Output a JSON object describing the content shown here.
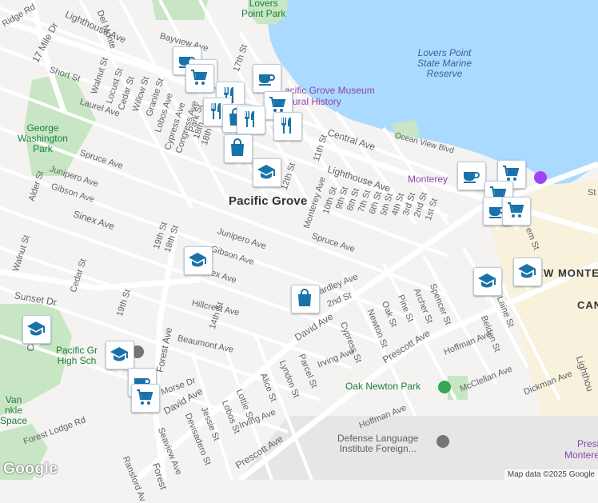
{
  "map": {
    "attribution": "Map data ©2025 Google",
    "logo": "Google",
    "city_labels": {
      "pacific_grove": "Pacific Grove",
      "new_monterey": "NEW MONTEREY",
      "cannery": "CAN"
    },
    "water_labels": {
      "lovers_point_reserve": "Lovers Point\nState Marine\nReserve"
    },
    "park_labels": {
      "lovers_point_park": "Lovers\nPoint Park",
      "george_washington_park": "George\nWashington\nPark",
      "pacific_grove_high": "Pacific Gr\nHigh Sch",
      "oak_newton_park": "Oak Newton Park",
      "van_winkle": "Van\nnkle\nSpace"
    },
    "poi_labels": {
      "museum": "acific Grove Museum\natural History",
      "monterey": "Monterey",
      "dli": "Defense Language\nInstitute Foreign...",
      "presidio": "Presid\nMonterey"
    },
    "streets": [
      {
        "name": "Lighthouse Ave",
        "key": "s1"
      },
      {
        "name": "Del Monte",
        "key": "s2"
      },
      {
        "name": "Ridge Rd",
        "key": "s3"
      },
      {
        "name": "17 Mile Dr",
        "key": "s4"
      },
      {
        "name": "Bayview Ave",
        "key": "s5"
      },
      {
        "name": "Short St",
        "key": "s6"
      },
      {
        "name": "Walnut St",
        "key": "s7"
      },
      {
        "name": "Locust St",
        "key": "s8"
      },
      {
        "name": "Cedar St",
        "key": "s9"
      },
      {
        "name": "Willow St",
        "key": "s10"
      },
      {
        "name": "Granite St",
        "key": "s11"
      },
      {
        "name": "Laurel Ave",
        "key": "s12"
      },
      {
        "name": "Lobos Ave",
        "key": "s13"
      },
      {
        "name": "Cypress Ave",
        "key": "s14"
      },
      {
        "name": "Congress Ave",
        "key": "s15"
      },
      {
        "name": "Park St",
        "key": "s16"
      },
      {
        "name": "18th",
        "key": "s17"
      },
      {
        "name": "18th",
        "key": "s18"
      },
      {
        "name": "17th St",
        "key": "s19"
      },
      {
        "name": "Central Ave",
        "key": "s20"
      },
      {
        "name": "Ocean View Blvd",
        "key": "s21"
      },
      {
        "name": "11th St",
        "key": "s22"
      },
      {
        "name": "Spruce Ave",
        "key": "s23"
      },
      {
        "name": "Junipero Ave",
        "key": "s24"
      },
      {
        "name": "Gibson Ave",
        "key": "s25"
      },
      {
        "name": "Alder St",
        "key": "s26"
      },
      {
        "name": "12th St",
        "key": "s27"
      },
      {
        "name": "Lighthouse Ave",
        "key": "s28"
      },
      {
        "name": "Monterey Ave",
        "key": "s29"
      },
      {
        "name": "10th St",
        "key": "s30"
      },
      {
        "name": "9th St",
        "key": "s31"
      },
      {
        "name": "8th St",
        "key": "s32"
      },
      {
        "name": "7th St",
        "key": "s33"
      },
      {
        "name": "6th St",
        "key": "s34"
      },
      {
        "name": "5th St",
        "key": "s35"
      },
      {
        "name": "4th St",
        "key": "s36"
      },
      {
        "name": "3rd St",
        "key": "s37"
      },
      {
        "name": "2nd St",
        "key": "s38"
      },
      {
        "name": "1st St",
        "key": "s39"
      },
      {
        "name": "Sinex Ave",
        "key": "s40"
      },
      {
        "name": "19th St",
        "key": "s41"
      },
      {
        "name": "18th St",
        "key": "s42"
      },
      {
        "name": "Junipero Ave",
        "key": "s43"
      },
      {
        "name": "Spruce Ave",
        "key": "s44"
      },
      {
        "name": "Gibson Ave",
        "key": "s45"
      },
      {
        "name": "Walnut St",
        "key": "s46"
      },
      {
        "name": "Cedar St",
        "key": "s47"
      },
      {
        "name": "Sunset Dr",
        "key": "s48"
      },
      {
        "name": "ex Ave",
        "key": "s49"
      },
      {
        "name": "Hillcrest Ave",
        "key": "s50"
      },
      {
        "name": "19th St",
        "key": "s51"
      },
      {
        "name": "Forest Ave",
        "key": "s52"
      },
      {
        "name": "14th St",
        "key": "s53"
      },
      {
        "name": "Beaumont Ave",
        "key": "s54"
      },
      {
        "name": "Cor",
        "key": "s55"
      },
      {
        "name": "ardley Ave",
        "key": "s56"
      },
      {
        "name": "2nd St",
        "key": "s57"
      },
      {
        "name": "David Ave",
        "key": "s58"
      },
      {
        "name": "Spencer St",
        "key": "s59"
      },
      {
        "name": "Archer St",
        "key": "s60"
      },
      {
        "name": "Pine St",
        "key": "s61"
      },
      {
        "name": "Oak St",
        "key": "s62"
      },
      {
        "name": "Newton St",
        "key": "s63"
      },
      {
        "name": "Cypress St",
        "key": "s64"
      },
      {
        "name": "Belden St",
        "key": "s65"
      },
      {
        "name": "Laine St",
        "key": "s66"
      },
      {
        "name": "Prescott Ave",
        "key": "s67"
      },
      {
        "name": "Hoffman Ave",
        "key": "s68"
      },
      {
        "name": "McClellan Ave",
        "key": "s69"
      },
      {
        "name": "Irving Ave",
        "key": "s70"
      },
      {
        "name": "Parcel St",
        "key": "s71"
      },
      {
        "name": "Lyndon St",
        "key": "s72"
      },
      {
        "name": "Alice St",
        "key": "s73"
      },
      {
        "name": "Morse Dr",
        "key": "s74"
      },
      {
        "name": "David Ave",
        "key": "s75"
      },
      {
        "name": "Lottie St",
        "key": "s76"
      },
      {
        "name": "Lobos St",
        "key": "s77"
      },
      {
        "name": "Jessie St",
        "key": "s78"
      },
      {
        "name": "Devisadero St",
        "key": "s79"
      },
      {
        "name": "Irving Ave",
        "key": "s80"
      },
      {
        "name": "Seaview Ave",
        "key": "s81"
      },
      {
        "name": "Forest Lodge Rd",
        "key": "s82"
      },
      {
        "name": "Ransford Av",
        "key": "s83"
      },
      {
        "name": "Forest",
        "key": "s84"
      },
      {
        "name": "Prescott Ave",
        "key": "s85"
      },
      {
        "name": "Hoffman Ave",
        "key": "s86"
      },
      {
        "name": "Dickman Ave",
        "key": "s87"
      },
      {
        "name": "Lighthou",
        "key": "s88"
      },
      {
        "name": "em St",
        "key": "s89"
      },
      {
        "name": "St",
        "key": "s90"
      }
    ],
    "markers": [
      {
        "icon": "coffee-icon",
        "key": "m1"
      },
      {
        "icon": "coffee-icon",
        "key": "m2"
      },
      {
        "icon": "shopping-cart-icon",
        "key": "m3"
      },
      {
        "icon": "coffee-icon",
        "key": "m4"
      },
      {
        "icon": "restaurant-icon",
        "key": "m5"
      },
      {
        "icon": "shopping-cart-icon",
        "key": "m6"
      },
      {
        "icon": "restaurant-icon",
        "key": "m7"
      },
      {
        "icon": "shopping-bag-icon",
        "key": "m8"
      },
      {
        "icon": "restaurant-icon",
        "key": "m9"
      },
      {
        "icon": "restaurant-icon",
        "key": "m10"
      },
      {
        "icon": "shopping-bag-icon",
        "key": "m11"
      },
      {
        "icon": "school-icon",
        "key": "m12"
      },
      {
        "icon": "coffee-icon",
        "key": "m13"
      },
      {
        "icon": "shopping-cart-icon",
        "key": "m14"
      },
      {
        "icon": "shopping-cart-icon",
        "key": "m15"
      },
      {
        "icon": "coffee-icon",
        "key": "m16"
      },
      {
        "icon": "shopping-cart-icon",
        "key": "m17"
      },
      {
        "icon": "school-icon",
        "key": "m18"
      },
      {
        "icon": "school-icon",
        "key": "m19"
      },
      {
        "icon": "school-icon",
        "key": "m20"
      },
      {
        "icon": "shopping-bag-icon",
        "key": "m21"
      },
      {
        "icon": "school-icon",
        "key": "m22"
      },
      {
        "icon": "school-icon",
        "key": "m23"
      },
      {
        "icon": "coffee-icon",
        "key": "m24"
      },
      {
        "icon": "shopping-cart-icon",
        "key": "m25"
      }
    ],
    "colors": {
      "water": "#aadaff",
      "park": "#c8e6c4",
      "road": "#ffffff",
      "land": "#f4f3f1",
      "marker_icon": "#1a73a8",
      "poi_purple": "#a142f4"
    }
  }
}
